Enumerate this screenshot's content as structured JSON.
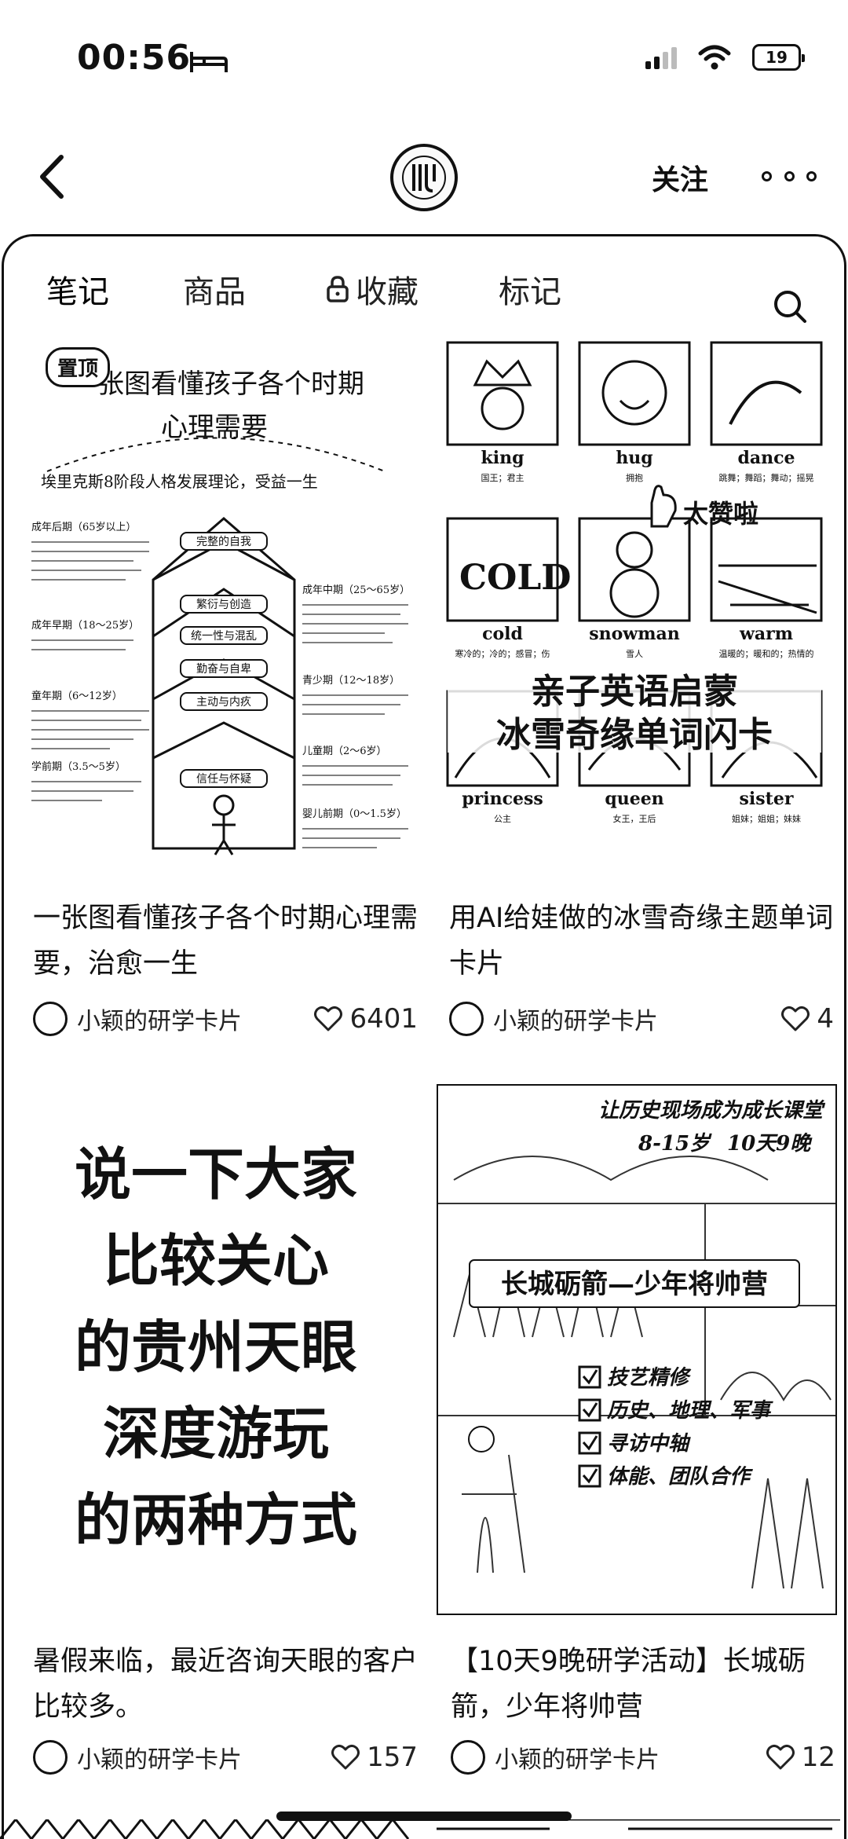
{
  "status_bar": {
    "time": "00:56",
    "battery": "19"
  },
  "header": {
    "follow_label": "关注"
  },
  "tabs": [
    {
      "label": "笔记"
    },
    {
      "label": "商品"
    },
    {
      "label": "收藏"
    },
    {
      "label": "标记"
    }
  ],
  "notes": [
    {
      "title": "一张图看懂孩子各个时期心理需要，治愈一生",
      "author": "小颖的研学卡片",
      "likes": "6401",
      "pinned_label": "置顶",
      "image_text": {
        "headline": "一张图看懂孩子各个时期",
        "headline2": "心理需要",
        "subtitle": "埃里克斯8阶段人格发展理论，受益一生",
        "stages_left": [
          "成年后期（65岁以上）",
          "成年早期（18～25岁）",
          "童年期（6～12岁）",
          "学前期（3.5～5岁）"
        ],
        "stages_right": [
          "成年中期（25～65岁）",
          "青少期（12～18岁）",
          "儿童期（2～6岁）",
          "婴儿前期（0～1.5岁）"
        ],
        "house_labels": [
          "完整的自我",
          "繁衍与创造",
          "统一性与混乱",
          "勤奋与自卑",
          "主动与内疚",
          "信任与怀疑"
        ]
      }
    },
    {
      "title": "用AI给娃做的冰雪奇缘主题单词卡片",
      "author": "小颖的研学卡片",
      "likes": "4",
      "image_text": {
        "words_row1": [
          "king",
          "hug",
          "dance"
        ],
        "words_row2": [
          "cold",
          "snowman",
          "warm"
        ],
        "words_row3": [
          "princess",
          "queen",
          "sister"
        ],
        "meanings_row1": [
          "国王；君主",
          "拥抱",
          "跳舞；舞蹈；舞动；摇晃"
        ],
        "meanings_row2": [
          "寒冷的；冷的；感冒；伤",
          "雪人",
          "温暖的；暖和的；热情的"
        ],
        "meanings_row3": [
          "公主",
          "女王，王后",
          "姐妹；姐姐；妹妹"
        ],
        "cold_sign": "COLD",
        "sticker": "太赞啦",
        "overlay_line1": "亲子英语启蒙",
        "overlay_line2": "冰雪奇缘单词闪卡"
      }
    },
    {
      "title": "暑假来临，最近咨询天眼的客户比较多。",
      "author": "小颖的研学卡片",
      "likes": "157",
      "image_text": {
        "lines": [
          "说一下大家",
          "比较关心",
          "的贵州天眼",
          "深度游玩",
          "的两种方式"
        ]
      }
    },
    {
      "title": "【10天9晚研学活动】长城砺箭，少年将帅营",
      "author": "小颖的研学卡片",
      "likes": "12",
      "image_text": {
        "banner": "让历史现场成为成长课堂",
        "age": "8-15岁",
        "duration": "10天9晚",
        "camp_name": "长城砺箭—少年将帅营",
        "checklist": [
          "技艺精修",
          "历史、地理、军事",
          "寻访中轴",
          "体能、团队合作"
        ]
      }
    }
  ]
}
